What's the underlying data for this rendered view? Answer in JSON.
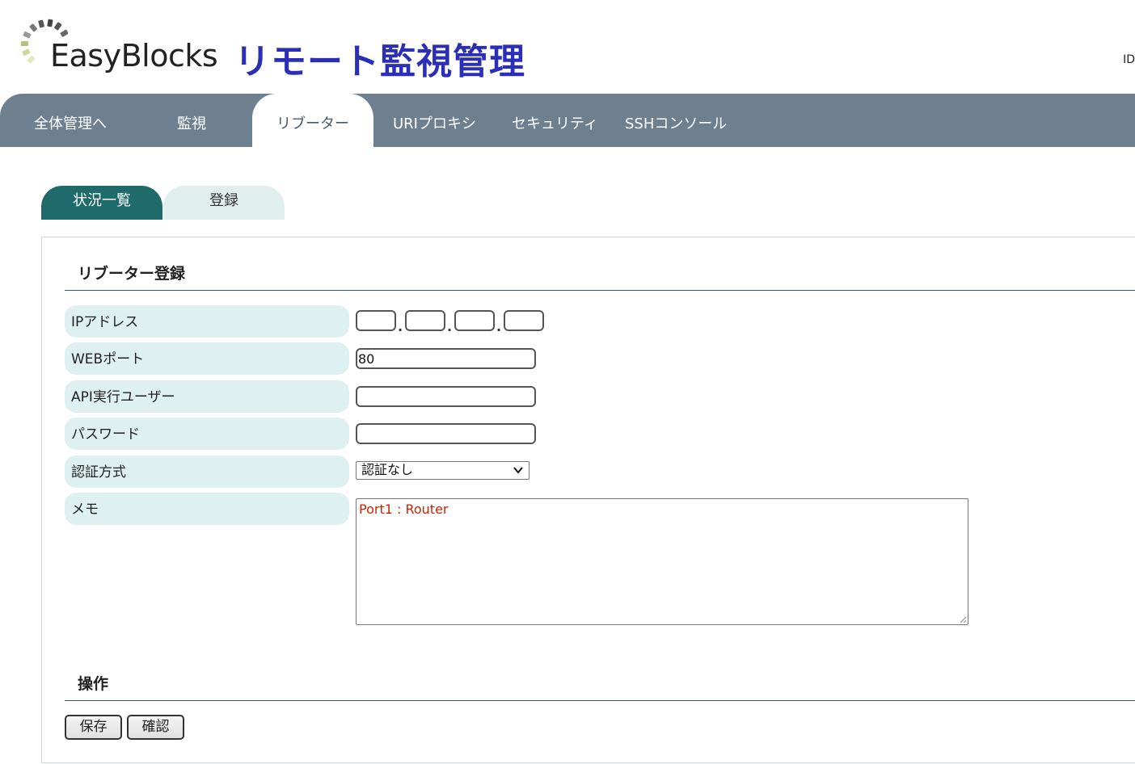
{
  "header": {
    "brand": "EasyBlocks",
    "subtitle": "リモート監視管理",
    "user_id_label": "ID"
  },
  "nav": {
    "tabs": [
      {
        "label": "全体管理へ",
        "active": false
      },
      {
        "label": "監視",
        "active": false
      },
      {
        "label": "リブーター",
        "active": true
      },
      {
        "label": "URIプロキシ",
        "active": false
      },
      {
        "label": "セキュリティ",
        "active": false
      },
      {
        "label": "SSHコンソール",
        "active": false
      }
    ]
  },
  "subtabs": [
    {
      "label": "状況一覧",
      "active": true
    },
    {
      "label": "登録",
      "active": false
    }
  ],
  "form": {
    "title": "リブーター登録",
    "ip_label": "IPアドレス",
    "ip_values": [
      "",
      "",
      "",
      ""
    ],
    "web_port_label": "WEBポート",
    "web_port_value": "80",
    "api_user_label": "API実行ユーザー",
    "api_user_value": "",
    "password_label": "パスワード",
    "password_value": "",
    "auth_label": "認証方式",
    "auth_selected": "認証なし",
    "memo_label": "メモ",
    "memo_value": "Port1 : Router"
  },
  "operations": {
    "title": "操作",
    "save_label": "保存",
    "confirm_label": "確認"
  },
  "colors": {
    "nav_bg": "#6e8090",
    "subtitle_blue": "#2b2fb8",
    "subtab_active": "#1f6a6a",
    "label_bg": "#dff0f0",
    "memo_text": "#cc2200"
  }
}
